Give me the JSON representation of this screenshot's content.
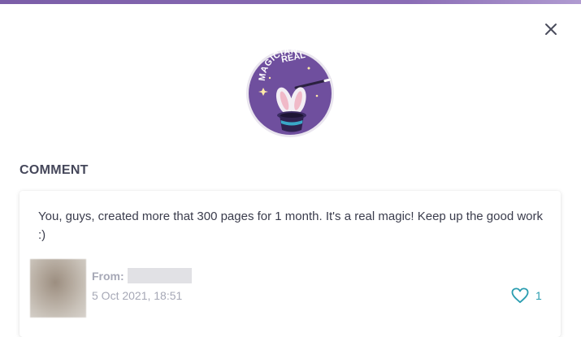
{
  "header": {
    "accent_color": "#7b5ea8"
  },
  "dialog": {
    "close_icon": "close-icon"
  },
  "badge": {
    "text_line1": "REAL",
    "text_line2": "MAGICIAN",
    "icon": "magic-hat-rabbit-icon",
    "color": "#6f4f9e"
  },
  "section": {
    "label": "COMMENT"
  },
  "comment": {
    "text": "You, guys, created more that 300 pages for 1 month. It's a real magic! Keep up the good work :)",
    "from_label": "From:",
    "timestamp": "5 Oct 2021, 18:51",
    "likes": "1",
    "like_icon": "heart-icon",
    "like_color": "#2a9db0"
  }
}
